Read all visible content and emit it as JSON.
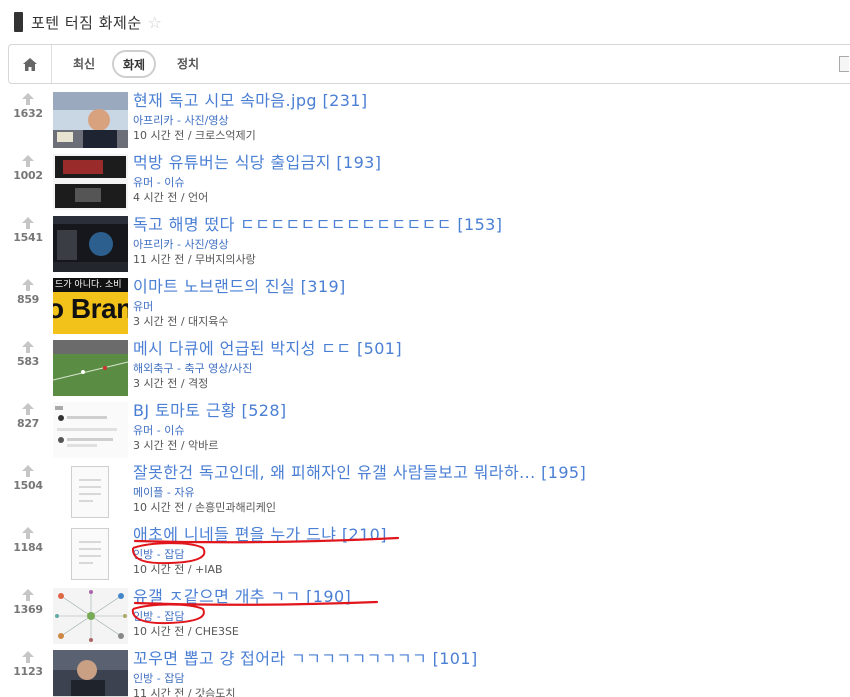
{
  "header": {
    "title": "포텐 터짐 화제순",
    "star": "☆"
  },
  "tabs": [
    {
      "label": "최신"
    },
    {
      "label": "화제"
    },
    {
      "label": "정치"
    }
  ],
  "posts": [
    {
      "votes": "1632",
      "title": "현재 독고 시모 속마음.jpg [231]",
      "category": "아프리카 - 사진/영상",
      "meta": "10 시간 전 / 크로스억제기",
      "thumb": "photo-streamer"
    },
    {
      "votes": "1002",
      "title": "먹방 유튜버는 식당 출입금지 [193]",
      "category": "유머 - 이슈",
      "meta": "4 시간 전 / 언어",
      "thumb": "screenshot-dark"
    },
    {
      "votes": "1541",
      "title": "독고 해명 떴다 ㄷㄷㄷㄷㄷㄷㄷㄷㄷㄷㄷㄷㄷㄷ [153]",
      "category": "아프리카 - 사진/영상",
      "meta": "11 시간 전 / 무버지의사랑",
      "thumb": "stream-dark"
    },
    {
      "votes": "859",
      "title": "이마트 노브랜드의 진실 [319]",
      "category": "유머",
      "meta": "3 시간 전 / 대지육수",
      "thumb": "nobrand",
      "thumb_text_top": "드가 아니다. 소비",
      "thumb_text_big": "o Bran"
    },
    {
      "votes": "583",
      "title": "메시 다큐에 언급된 박지성 ㄷㄷ [501]",
      "category": "해외축구 - 축구 영상/사진",
      "meta": "3 시간 전 / 격정",
      "thumb": "soccer-field"
    },
    {
      "votes": "827",
      "title": "BJ 토마토 근황 [528]",
      "category": "유머 - 이슈",
      "meta": "3 시간 전 / 악바르",
      "thumb": "chat-screenshot"
    },
    {
      "votes": "1504",
      "title": "잘못한건 독고인데, 왜 피해자인 유갤 사람들보고 뭐라하... [195]",
      "category": "메이플 - 자유",
      "meta": "10 시간 전 / 손흥민과해리케인",
      "thumb": "document-placeholder"
    },
    {
      "votes": "1184",
      "title": "애초에 니네들 편을 누가 드냐 [210]",
      "category": "인방 - 잡담",
      "meta": "10 시간 전 / +IAB",
      "thumb": "document-placeholder"
    },
    {
      "votes": "1369",
      "title": "유갤 ㅈ같으면 개추 ㄱㄱ [190]",
      "category": "인방 - 잡담",
      "meta": "10 시간 전 / CHE3SE",
      "thumb": "network-diagram"
    },
    {
      "votes": "1123",
      "title": "꼬우면 뽑고 걍 접어라 ㄱㄱㄱㄱㄱㄱㄱㄱㄱ [101]",
      "category": "인방 - 잡담",
      "meta": "11 시간 전 / 갓슴도치",
      "thumb": "photo-person"
    }
  ],
  "colors": {
    "title_link": "#4a7fd4",
    "category_link": "#3f6fc2",
    "annotation": "#e0161c"
  }
}
